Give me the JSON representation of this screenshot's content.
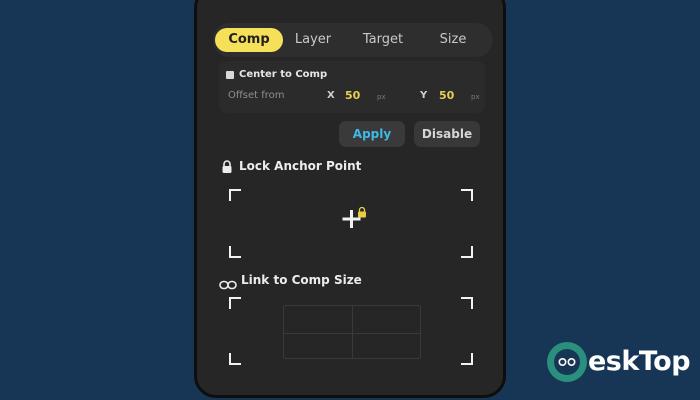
{
  "tabs": [
    {
      "label": "Comp",
      "active": true
    },
    {
      "label": "Layer",
      "active": false
    },
    {
      "label": "Target",
      "active": false
    },
    {
      "label": "Size",
      "active": false
    }
  ],
  "options": {
    "center_label": "Center to Comp",
    "offset_label": "Offset from",
    "x_axis": "X",
    "x_value": "50",
    "x_unit": "px",
    "y_axis": "Y",
    "y_value": "50",
    "y_unit": "px"
  },
  "buttons": {
    "apply_label": "Apply",
    "disable_label": "Disable"
  },
  "anchor": {
    "title": "Lock Anchor Point",
    "icon": "lock-icon",
    "center_icon": "crosshair-lock-icon"
  },
  "link": {
    "title": "Link to Comp Size",
    "icon": "link-icon"
  },
  "watermark": {
    "text": "eskTop",
    "logo": "desktop-logo-icon"
  },
  "colors": {
    "background": "#173656",
    "panel": "#262626",
    "active_tab": "#f6e05a",
    "value_yellow": "#e6cf55",
    "apply_blue": "#3fb9e6",
    "watermark_teal": "#2a8f7c"
  }
}
